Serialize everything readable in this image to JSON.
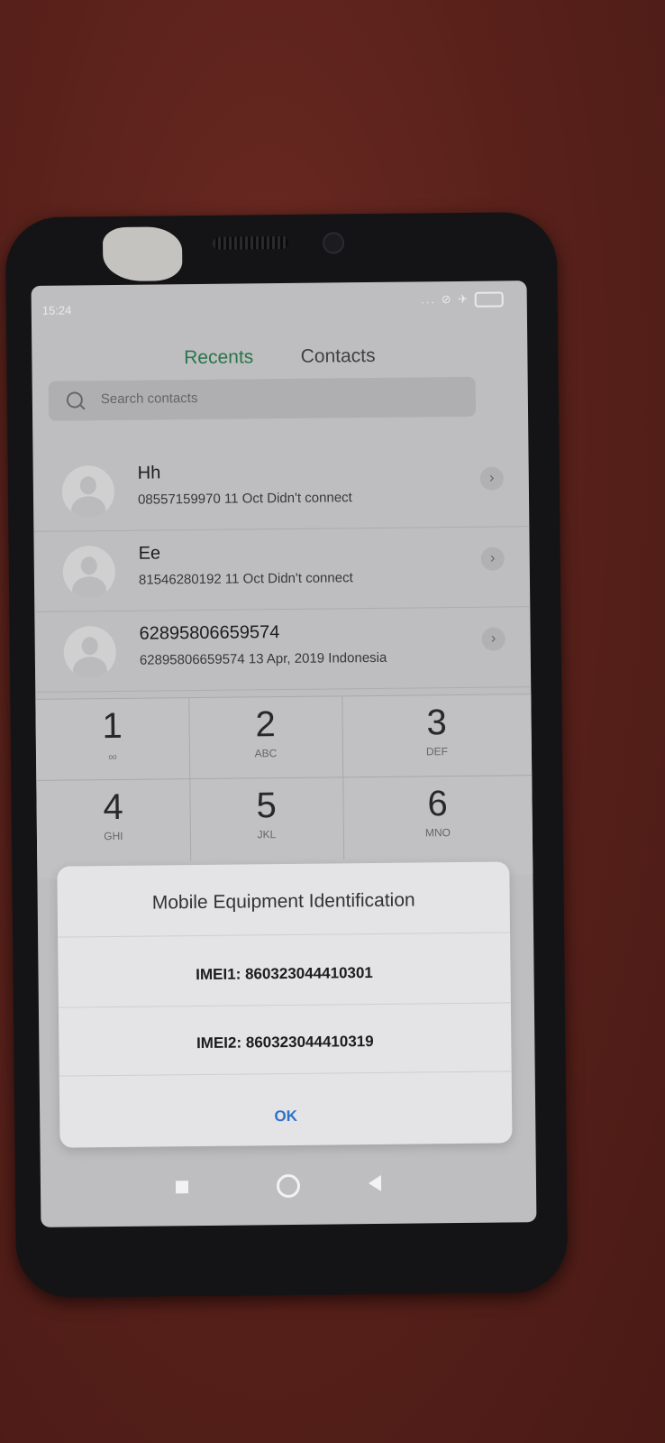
{
  "status_bar": {
    "time": "15:24",
    "icons": "... ⊘ ✈"
  },
  "tabs": [
    "Recents",
    "Contacts"
  ],
  "search": {
    "placeholder": "Search contacts"
  },
  "recents": [
    {
      "name": "Hh",
      "detail": "08557159970  11 Oct  Didn't connect"
    },
    {
      "name": "Ee",
      "detail": "81546280192  11 Oct  Didn't connect"
    },
    {
      "name": "62895806659574",
      "detail": "62895806659574  13 Apr, 2019  Indonesia"
    }
  ],
  "keypad": [
    {
      "digit": "1",
      "letters": "ₒₒ"
    },
    {
      "digit": "2",
      "letters": "ABC"
    },
    {
      "digit": "3",
      "letters": "DEF"
    },
    {
      "digit": "4",
      "letters": "GHI"
    },
    {
      "digit": "5",
      "letters": "JKL"
    },
    {
      "digit": "6",
      "letters": "MNO"
    }
  ],
  "dialog": {
    "title": "Mobile Equipment Identification",
    "imei1": "IMEI1: 860323044410301",
    "imei2": "IMEI2: 860323044410319",
    "ok": "OK"
  }
}
